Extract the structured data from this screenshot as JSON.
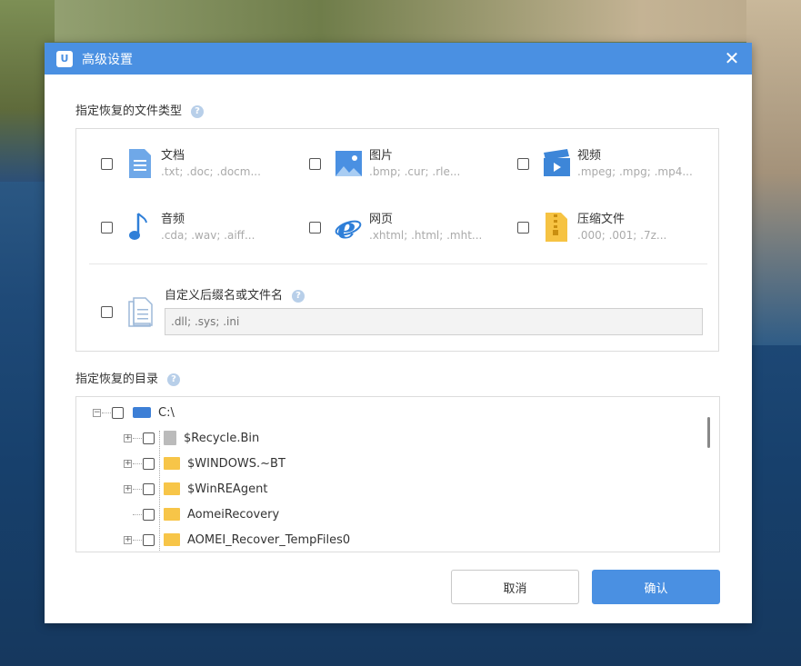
{
  "dialog": {
    "title": "高级设置",
    "close_symbol": "✕"
  },
  "types_section": {
    "label": "指定恢复的文件类型",
    "help": "?",
    "items": [
      {
        "name": "文档",
        "ext": ".txt; .doc; .docm...",
        "icon": "document-icon",
        "color": "#6fa8e8"
      },
      {
        "name": "图片",
        "ext": ".bmp; .cur; .rle...",
        "icon": "image-icon",
        "color": "#4a90e2"
      },
      {
        "name": "视频",
        "ext": ".mpeg; .mpg; .mp4...",
        "icon": "video-icon",
        "color": "#3d86d8"
      },
      {
        "name": "音频",
        "ext": ".cda; .wav; .aiff...",
        "icon": "music-icon",
        "color": "#2f7fd8"
      },
      {
        "name": "网页",
        "ext": ".xhtml; .html; .mht...",
        "icon": "browser-icon",
        "color": "#2f7fd8"
      },
      {
        "name": "压缩文件",
        "ext": ".000; .001; .7z...",
        "icon": "zip-icon",
        "color": "#f6c343"
      }
    ],
    "custom": {
      "label": "自定义后缀名或文件名",
      "placeholder": ".dll; .sys; .ini"
    }
  },
  "directory_section": {
    "label": "指定恢复的目录",
    "help": "?",
    "root": "C:\\",
    "items": [
      {
        "label": "$Recycle.Bin",
        "type": "trash",
        "expandable": true
      },
      {
        "label": "$WINDOWS.~BT",
        "type": "folder",
        "expandable": true
      },
      {
        "label": "$WinREAgent",
        "type": "folder",
        "expandable": true
      },
      {
        "label": "AomeiRecovery",
        "type": "folder",
        "expandable": false
      },
      {
        "label": "AOMEI_Recover_TempFiles0",
        "type": "folder",
        "expandable": true
      }
    ]
  },
  "buttons": {
    "cancel": "取消",
    "ok": "确认"
  },
  "colors": {
    "accent": "#4a90e2"
  }
}
